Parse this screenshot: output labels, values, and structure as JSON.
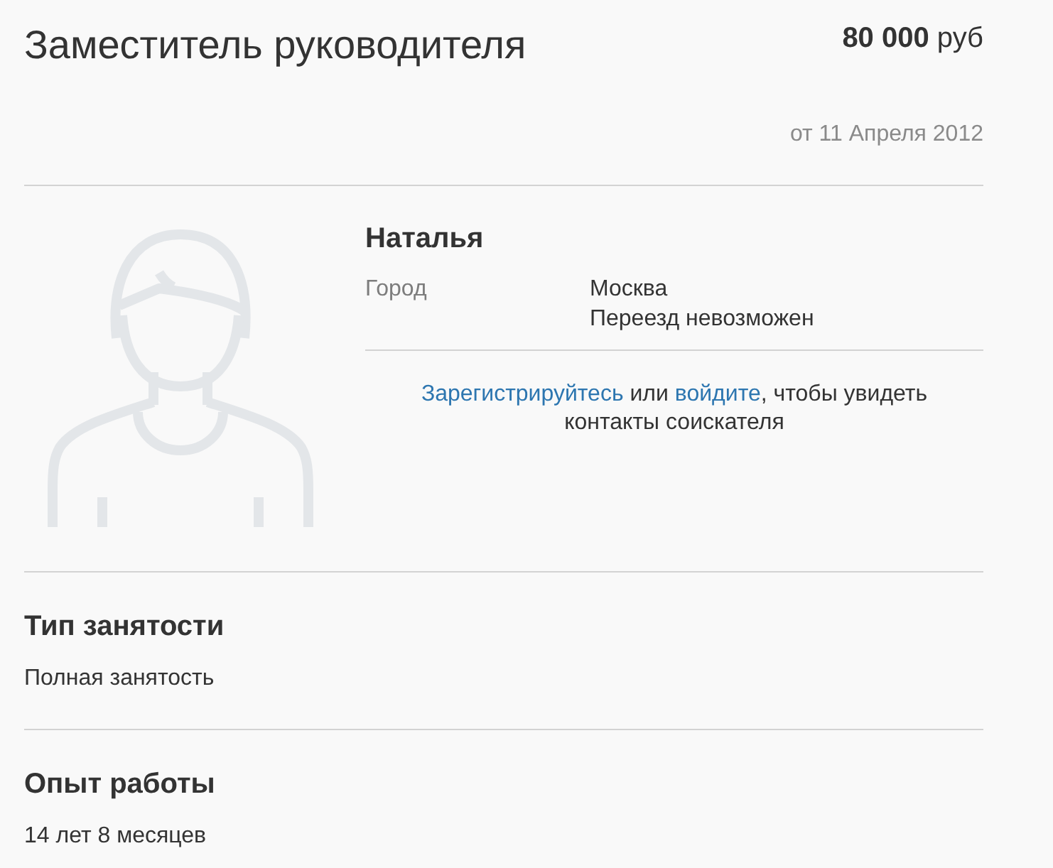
{
  "header": {
    "title": "Заместитель руководителя",
    "salary": "**80 000** руб",
    "date": "от 11 Апреля 2012"
  },
  "candidate": {
    "name": "Наталья",
    "fields": [
      {
        "label": "Город",
        "values": [
          "Москва",
          "Переезд невозможен"
        ]
      }
    ],
    "contact_notice": [
      {
        "kind": "link",
        "text": "Зарегистрируйтесь"
      },
      {
        "kind": "text",
        "text": " или "
      },
      {
        "kind": "link",
        "text": "войдите"
      },
      {
        "kind": "text",
        "text": ", чтобы увидеть контакты соискателя"
      }
    ]
  },
  "sections": [
    {
      "heading": "Тип занятости",
      "text": "Полная занятость"
    },
    {
      "heading": "Опыт работы",
      "text": "14 лет 8 месяцев"
    }
  ]
}
